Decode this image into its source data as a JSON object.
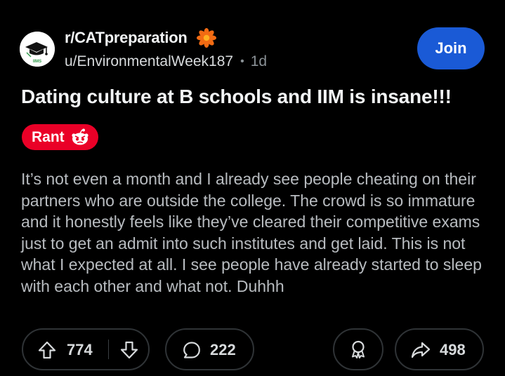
{
  "subreddit": {
    "name": "r/CATpreparation",
    "avatar_icon": "graduation-cap-icon",
    "avatar_text": "IIMS",
    "join_label": "Join"
  },
  "author": {
    "username": "u/EnvironmentalWeek187",
    "age": "1d"
  },
  "post": {
    "title": "Dating culture at B schools and IIM is insane!!!",
    "flair": "Rant",
    "flair_icon": "angry-snoo-icon",
    "body": "It’s not even a month and I already see people cheating on their partners who are outside the college. The crowd is so immature and it honestly feels like they’ve cleared their competitive exams just to get an admit into such institutes and get laid. This is not what I expected at all. I see people have already started to sleep with each other and what not. Duhhh"
  },
  "actions": {
    "score": "774",
    "comments": "222",
    "shares": "498"
  },
  "colors": {
    "background": "#000000",
    "join_button": "#1a5ad6",
    "flair": "#ea0027",
    "award_flower": "#f26b13"
  }
}
